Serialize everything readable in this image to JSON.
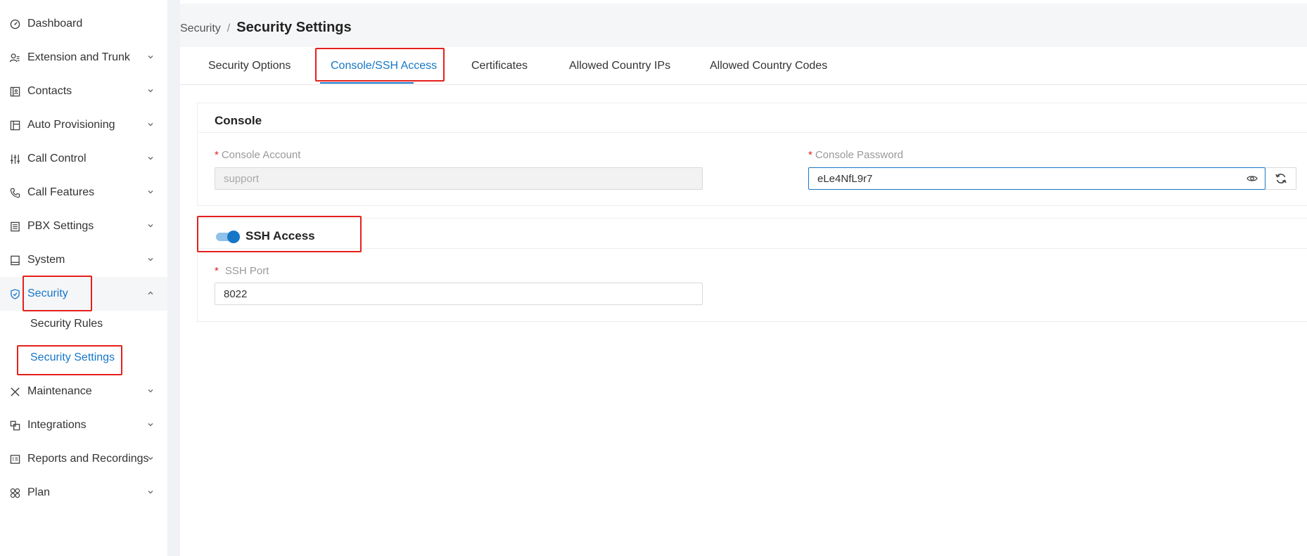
{
  "sidebar": {
    "items": [
      {
        "label": "Dashboard",
        "icon": "dashboard-icon"
      },
      {
        "label": "Extension and Trunk",
        "icon": "user-list-icon"
      },
      {
        "label": "Contacts",
        "icon": "contacts-icon"
      },
      {
        "label": "Auto Provisioning",
        "icon": "provisioning-icon"
      },
      {
        "label": "Call Control",
        "icon": "sliders-icon"
      },
      {
        "label": "Call Features",
        "icon": "phone-icon"
      },
      {
        "label": "PBX Settings",
        "icon": "pbx-icon"
      },
      {
        "label": "System",
        "icon": "monitor-icon"
      },
      {
        "label": "Security",
        "icon": "shield-icon"
      },
      {
        "label": "Maintenance",
        "icon": "tools-icon"
      },
      {
        "label": "Integrations",
        "icon": "integrations-icon"
      },
      {
        "label": "Reports and Recordings",
        "icon": "report-icon"
      },
      {
        "label": "Plan",
        "icon": "plan-icon"
      }
    ],
    "security_sub": [
      {
        "label": "Security Rules"
      },
      {
        "label": "Security Settings"
      }
    ]
  },
  "breadcrumb": {
    "parent": "Security",
    "separator": "/",
    "current": "Security Settings"
  },
  "tabs": [
    {
      "label": "Security Options"
    },
    {
      "label": "Console/SSH Access"
    },
    {
      "label": "Certificates"
    },
    {
      "label": "Allowed Country IPs"
    },
    {
      "label": "Allowed Country Codes"
    }
  ],
  "console": {
    "title": "Console",
    "account_label": "Console Account",
    "account_value": "support",
    "password_label": "Console Password",
    "password_value": "eLe4NfL9r7",
    "required_mark": "*"
  },
  "ssh": {
    "title": "SSH Access",
    "enabled": true,
    "port_label": "SSH Port",
    "port_value": "8022",
    "required_mark": "*"
  },
  "colors": {
    "accent": "#1677c8",
    "highlight": "#e5201c"
  }
}
